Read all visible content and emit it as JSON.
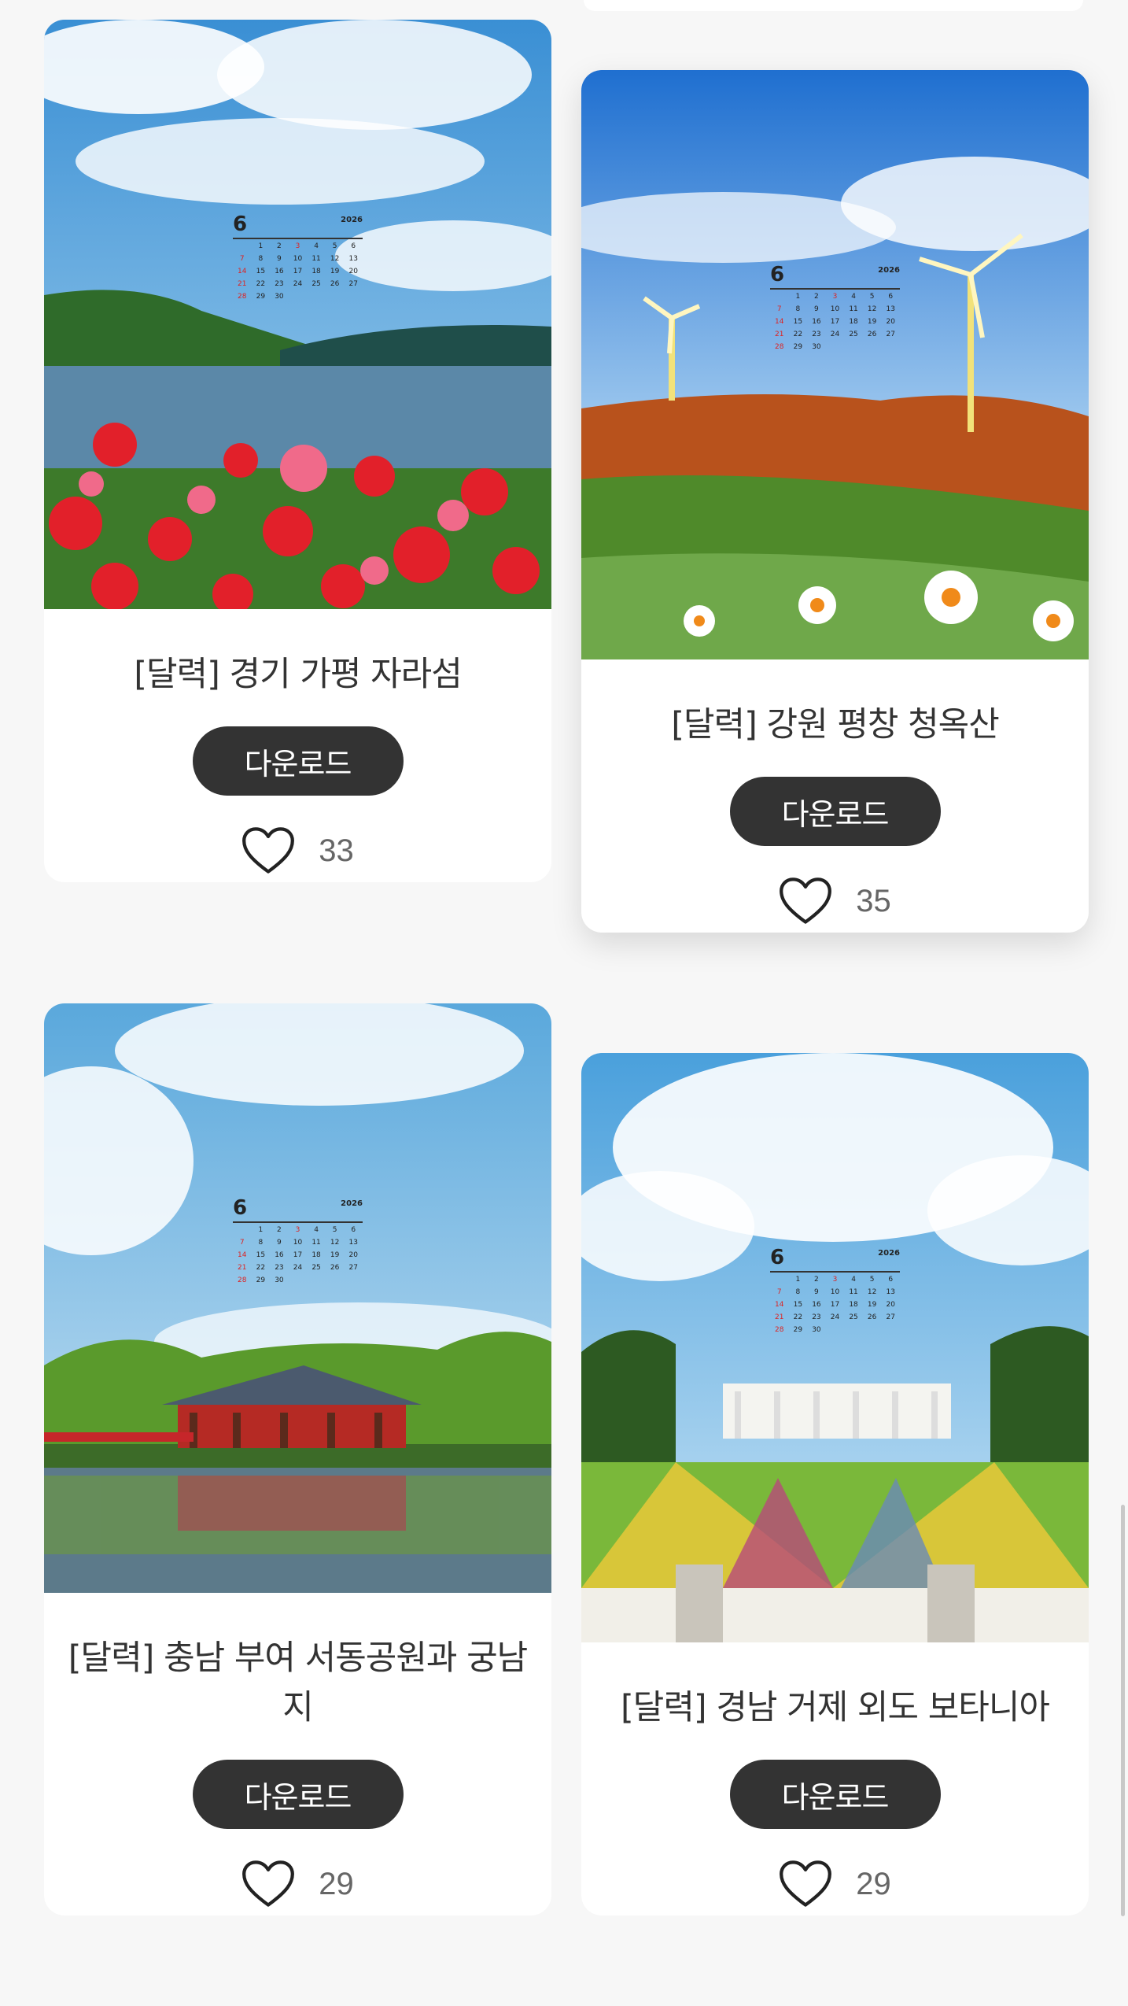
{
  "cards": [
    {
      "title": "[달력] 경기 가평 자라섬",
      "button": "다운로드",
      "likes": "33"
    },
    {
      "title": "[달력] 강원 평창 청옥산",
      "button": "다운로드",
      "likes": "35"
    },
    {
      "title": "[달력] 충남 부여 서동공원과 궁남지",
      "button": "다운로드",
      "likes": "29"
    },
    {
      "title": "[달력] 경남 거제 외도 보타니아",
      "button": "다운로드",
      "likes": "29"
    }
  ],
  "calendar": {
    "month": "6",
    "year": "2026",
    "days": [
      "1",
      "2",
      "3",
      "4",
      "5",
      "6",
      "7",
      "8",
      "9",
      "10",
      "11",
      "12",
      "13",
      "14",
      "15",
      "16",
      "17",
      "18",
      "19",
      "20",
      "21",
      "22",
      "23",
      "24",
      "25",
      "26",
      "27",
      "28",
      "29",
      "30"
    ]
  }
}
